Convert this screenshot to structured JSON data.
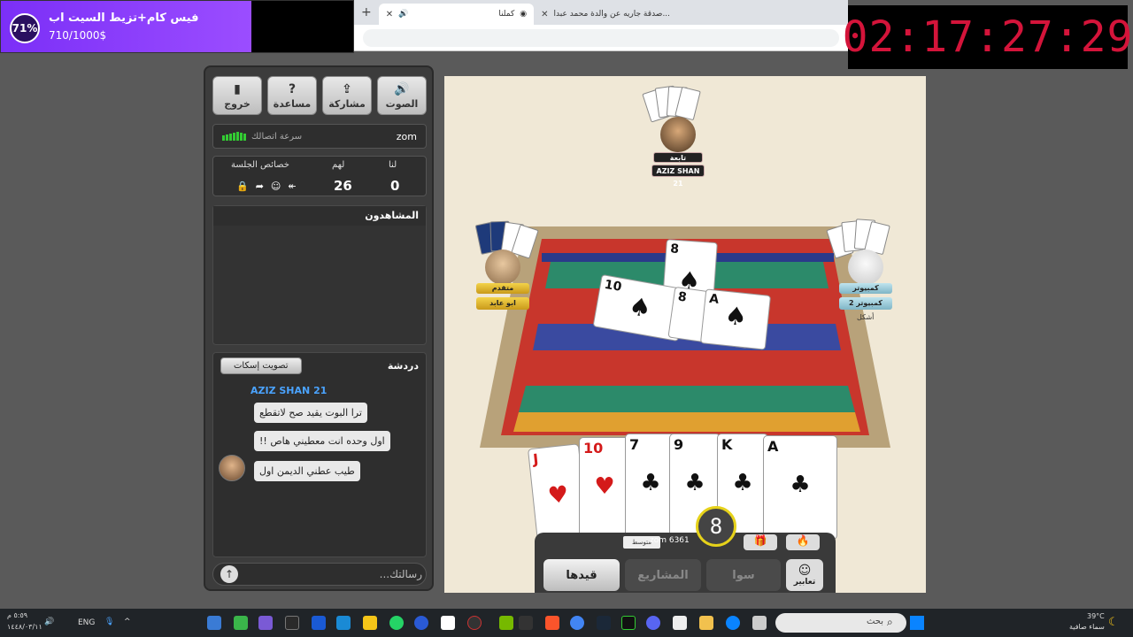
{
  "stream": {
    "goal_percent": "71%",
    "goal_title": "فيس كام+تزيط السيت اب",
    "goal_value": "710/1000$",
    "goal_fraction": 0.71,
    "countdown": "02:17:27:29"
  },
  "browser": {
    "tabs": [
      {
        "label": "صدقة جاريه عن والدة محمد عبدا..."
      },
      {
        "label": "كملنا"
      }
    ],
    "new_tab": "+"
  },
  "panel": {
    "buttons": {
      "exit": "خروج",
      "help": "مساعدة",
      "share": "مشاركة",
      "sound": "الصوت"
    },
    "connection": {
      "username": "zom",
      "label": "سرعة اتصالك"
    },
    "score": {
      "us_label": "لنا",
      "them_label": "لهم",
      "session_label": "خصائص الجلسة",
      "us_value": "0",
      "them_value": "26"
    },
    "viewers_title": "المشاهدون",
    "chat": {
      "title": "دردشة",
      "mute_button": "تصويت إسكات",
      "author": "AZIZ SHAN 21",
      "messages": [
        "ترا البوت يقيد صح لاتقطع",
        "اول وحده انت معطيني هاص !!",
        "طيب عطني الديمن اول"
      ]
    },
    "message_placeholder": "رسالتك..."
  },
  "game": {
    "players": {
      "top": {
        "name": "AZIZ SHAN 21",
        "tag": "تابعة"
      },
      "left": {
        "name": "ابو عابد",
        "tag": "متقدم"
      },
      "right": {
        "name": "كمبيوتر 2",
        "tag": "كمبيوتر",
        "sub": "أشكل"
      }
    },
    "table_cards": [
      {
        "rank": "8",
        "suit": "♠"
      },
      {
        "rank": "10",
        "suit": "♠"
      },
      {
        "rank": "8",
        "suit": "♠"
      },
      {
        "rank": "A",
        "suit": "♠"
      }
    ],
    "hand": [
      {
        "rank": "J",
        "suit": "♥",
        "color": "red"
      },
      {
        "rank": "10",
        "suit": "♥",
        "color": "red"
      },
      {
        "rank": "7",
        "suit": "♣",
        "color": "black"
      },
      {
        "rank": "9",
        "suit": "♣",
        "color": "black"
      },
      {
        "rank": "K",
        "suit": "♣",
        "color": "black"
      },
      {
        "rank": "A",
        "suit": "♣",
        "color": "black"
      }
    ],
    "turn_number": "8",
    "self_label": "zom 6361",
    "rank_badge": "متوسط",
    "buttons": {
      "qaydha": "قيدها",
      "projects": "المشاريع",
      "sawa": "سوا",
      "expressions": "تعابير"
    }
  },
  "taskbar": {
    "time": "٥:٥٩ م",
    "date": "١٤٤٨/٠٣/١١",
    "lang": "ENG",
    "search_placeholder": "بحث",
    "temp": "39°C",
    "weather": "سماء صافية"
  },
  "colors": {
    "timer": "#d4143a",
    "goal": "#8a3dfc",
    "accent_blue": "#4aa3ff",
    "turn_ring": "#e6d21a"
  }
}
